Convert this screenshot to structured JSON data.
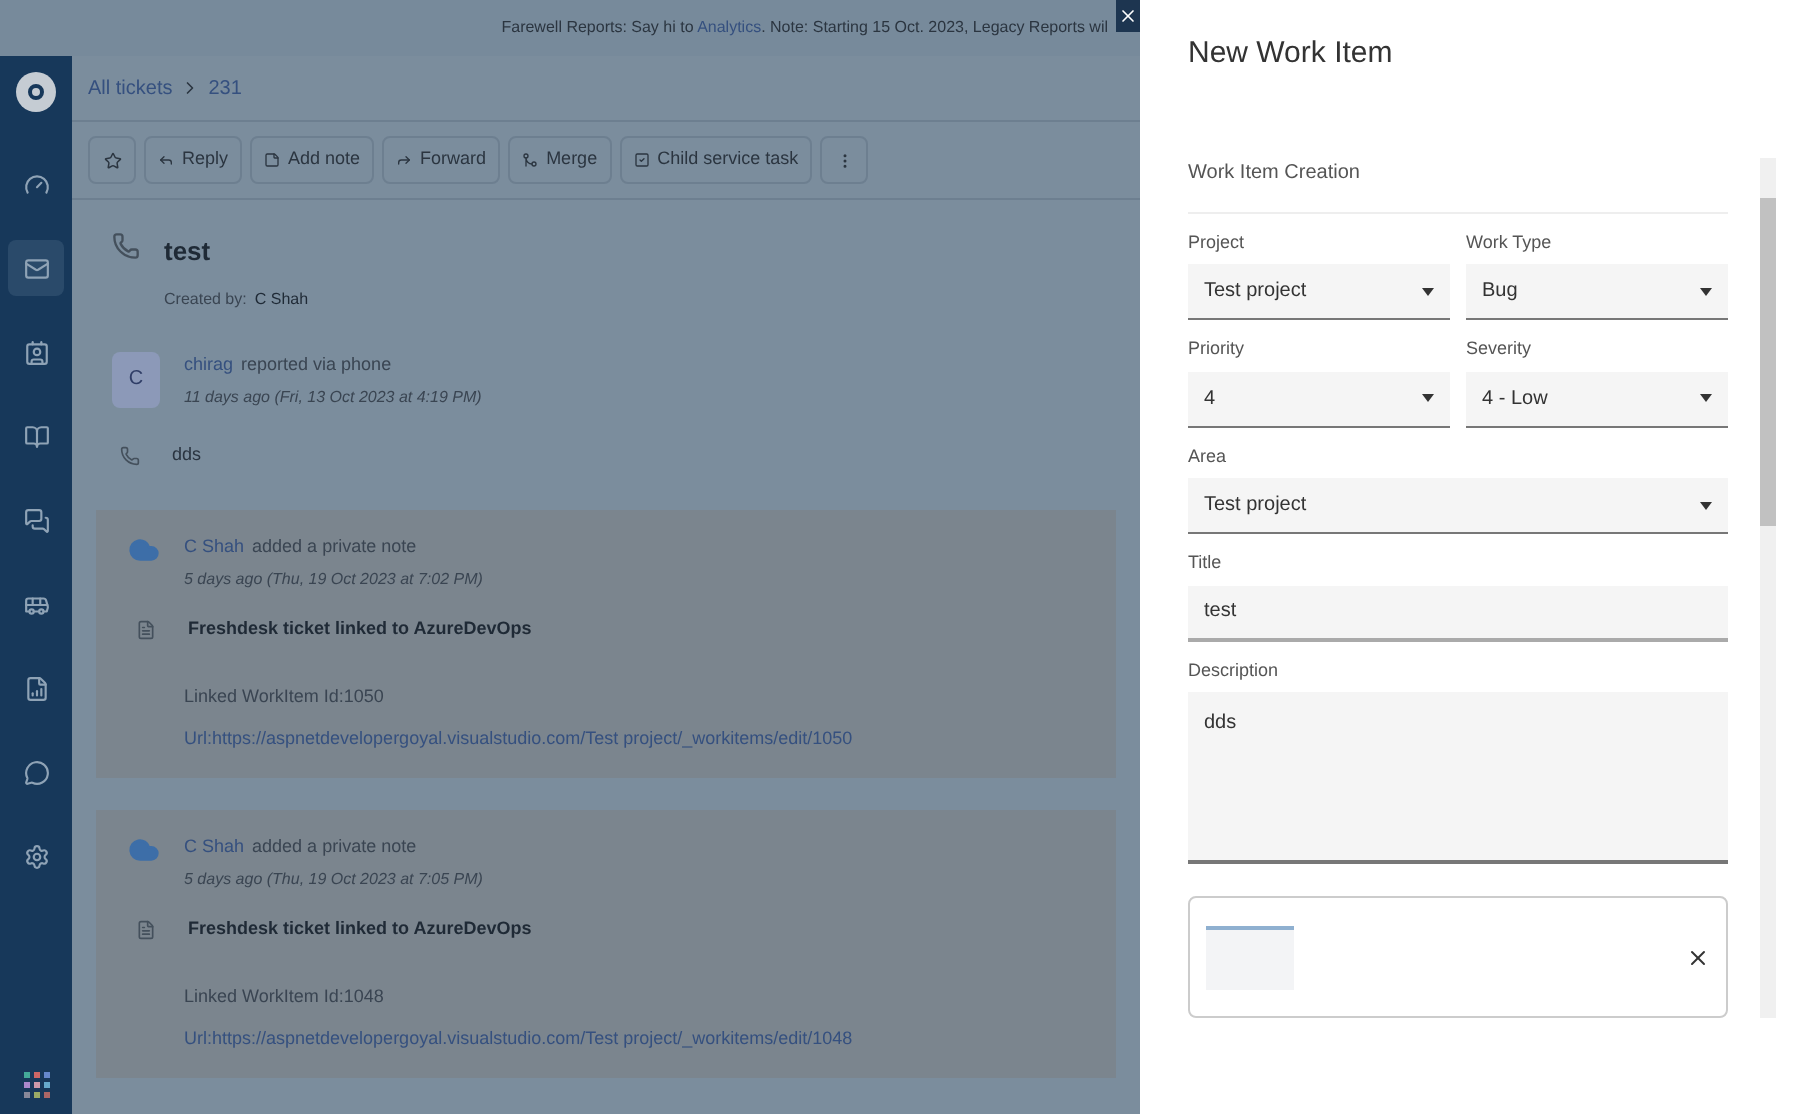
{
  "banner": {
    "text_before": "Farewell Reports: Say hi to ",
    "link": "Analytics",
    "text_after": ". Note: Starting 15 Oct. 2023, Legacy Reports wil"
  },
  "sidebar": {
    "items": [
      {
        "selected": false
      },
      {
        "selected": true
      },
      {
        "selected": false
      },
      {
        "selected": false
      },
      {
        "selected": false
      },
      {
        "selected": false
      },
      {
        "selected": false
      },
      {
        "selected": false
      },
      {
        "selected": false
      }
    ]
  },
  "breadcrumb": [
    "All tickets",
    "231"
  ],
  "toolbar": {
    "buttons": [
      "Reply",
      "Add note",
      "Forward",
      "Merge",
      "Child service task"
    ]
  },
  "ticket": {
    "title": "test",
    "created_by_label": "Created by:",
    "created_by": "C Shah"
  },
  "conversation": [
    {
      "kind": "reported",
      "avatar": "C",
      "author": "chirag",
      "action": "reported via phone",
      "time": "11 days ago (Fri, 13 Oct 2023 at 4:19 PM)",
      "body": "dds"
    },
    {
      "kind": "note",
      "author": "C Shah",
      "action": "added a private note",
      "time": "5 days ago (Thu, 19 Oct 2023 at 7:02 PM)",
      "heading": "Freshdesk ticket linked to AzureDevOps",
      "lines": [
        "Linked WorkItem Id:1050",
        "Url:https://aspnetdevelopergoyal.visualstudio.com/Test project/_workitems/edit/1050"
      ]
    },
    {
      "kind": "note",
      "author": "C Shah",
      "action": "added a private note",
      "time": "5 days ago (Thu, 19 Oct 2023 at 7:05 PM)",
      "heading": "Freshdesk ticket linked to AzureDevOps",
      "lines": [
        "Linked WorkItem Id:1048",
        "Url:https://aspnetdevelopergoyal.visualstudio.com/Test project/_workitems/edit/1048"
      ]
    }
  ],
  "panel": {
    "title": "New Work Item",
    "section": "Work Item Creation",
    "rows": [
      [
        {
          "kind": "select",
          "label": "Project",
          "value": "Test project"
        },
        {
          "kind": "select",
          "label": "Work Type",
          "value": "Bug"
        }
      ],
      [
        {
          "kind": "select",
          "label": "Priority",
          "value": "4"
        },
        {
          "kind": "select",
          "label": "Severity",
          "value": "4 - Low"
        }
      ],
      [
        {
          "kind": "select",
          "label": "Area",
          "value": "Test project"
        }
      ],
      [
        {
          "kind": "text",
          "label": "Title",
          "value": "test"
        }
      ],
      [
        {
          "kind": "textarea",
          "label": "Description",
          "value": "dds"
        }
      ]
    ]
  }
}
